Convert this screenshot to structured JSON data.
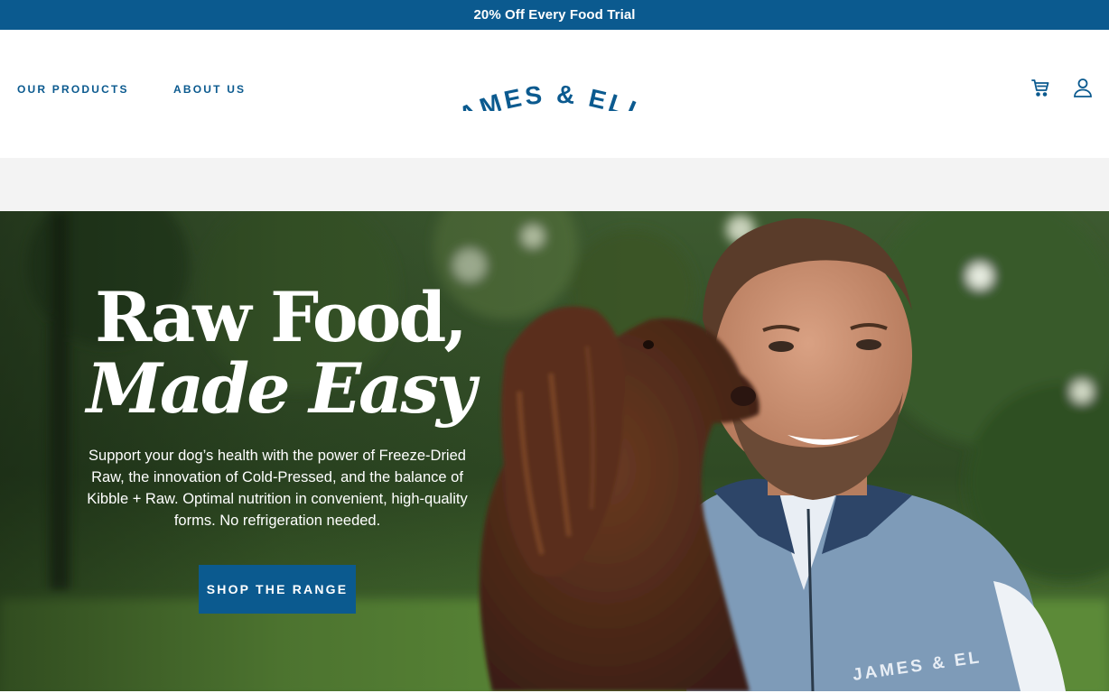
{
  "promo": {
    "text": "20% Off Every Food Trial"
  },
  "nav": {
    "items": [
      {
        "label": "OUR PRODUCTS"
      },
      {
        "label": "ABOUT US"
      }
    ]
  },
  "logo": {
    "text": "JAMES & ELLA"
  },
  "header_icons": [
    "cart-icon",
    "account-icon"
  ],
  "hero": {
    "title_line1": "Raw Food,",
    "title_line2": "Made Easy",
    "description": "Support your dog’s health with the power of Freeze-Dried Raw, the innovation of Cold-Pressed, and the balance of Kibble + Raw. Optimal nutrition in convenient, high-quality forms. No refrigeration needed.",
    "cta_label": "SHOP THE RANGE",
    "vest_text": "JAMES & EL"
  },
  "colors": {
    "brand_blue": "#0b5a8f",
    "promo_bg": "#0b5a8f",
    "band_gray": "#f3f3f3",
    "text_white": "#ffffff"
  }
}
